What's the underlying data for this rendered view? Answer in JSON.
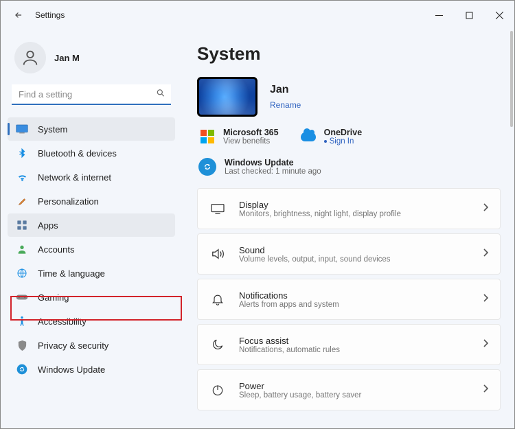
{
  "titlebar": {
    "title": "Settings"
  },
  "user": {
    "name": "Jan M"
  },
  "search": {
    "placeholder": "Find a setting"
  },
  "sidebar": {
    "items": [
      {
        "label": "System"
      },
      {
        "label": "Bluetooth & devices"
      },
      {
        "label": "Network & internet"
      },
      {
        "label": "Personalization"
      },
      {
        "label": "Apps"
      },
      {
        "label": "Accounts"
      },
      {
        "label": "Time & language"
      },
      {
        "label": "Gaming"
      },
      {
        "label": "Accessibility"
      },
      {
        "label": "Privacy & security"
      },
      {
        "label": "Windows Update"
      }
    ]
  },
  "page": {
    "title": "System"
  },
  "profile": {
    "device_name": "Jan",
    "rename": "Rename"
  },
  "ms365": {
    "title": "Microsoft 365",
    "sub": "View benefits"
  },
  "onedrive": {
    "title": "OneDrive",
    "sub": "Sign In"
  },
  "update": {
    "title": "Windows Update",
    "sub": "Last checked: 1 minute ago"
  },
  "cards": [
    {
      "title": "Display",
      "sub": "Monitors, brightness, night light, display profile"
    },
    {
      "title": "Sound",
      "sub": "Volume levels, output, input, sound devices"
    },
    {
      "title": "Notifications",
      "sub": "Alerts from apps and system"
    },
    {
      "title": "Focus assist",
      "sub": "Notifications, automatic rules"
    },
    {
      "title": "Power",
      "sub": "Sleep, battery usage, battery saver"
    }
  ]
}
